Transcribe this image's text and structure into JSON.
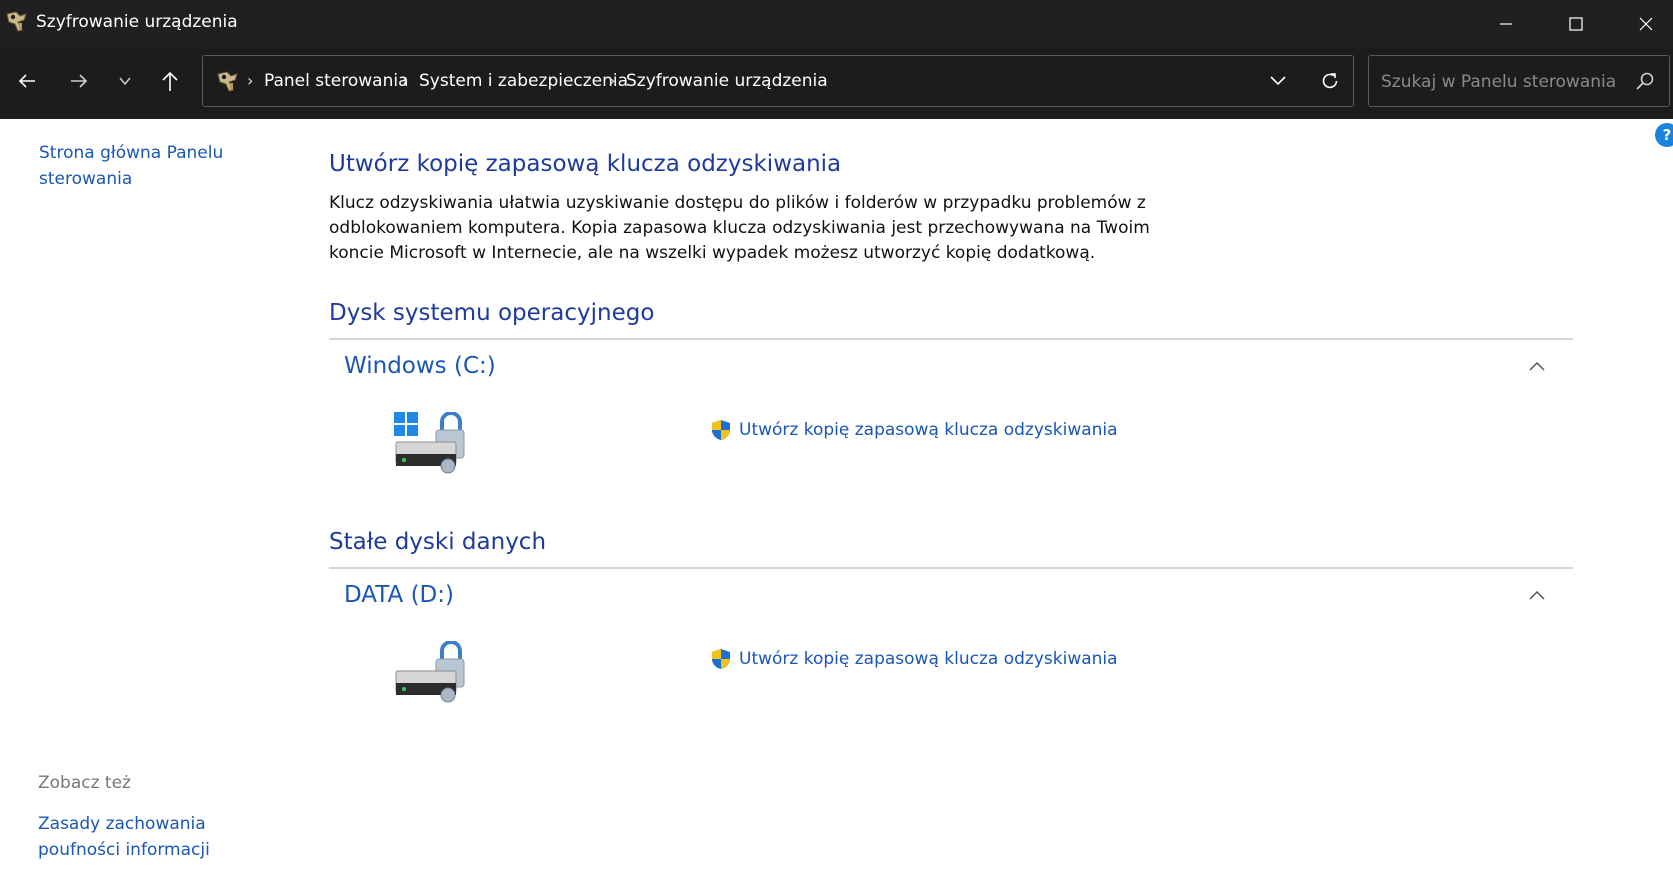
{
  "window": {
    "title": "Szyfrowanie urządzenia",
    "controls": [
      "minimize",
      "maximize",
      "close"
    ]
  },
  "nav": {
    "breadcrumbs": [
      "Panel sterowania",
      "System i zabezpieczenia",
      "Szyfrowanie urządzenia"
    ],
    "search_placeholder": "Szukaj w Panelu sterowania"
  },
  "sidebar": {
    "home_link": "Strona główna Panelu sterowania",
    "see_also_heading": "Zobacz też",
    "see_also_links": [
      "Zasady zachowania poufności informacji"
    ]
  },
  "main": {
    "title": "Utwórz kopię zapasową klucza odzyskiwania",
    "description": "Klucz odzyskiwania ułatwia uzyskiwanie dostępu do plików i folderów w przypadku problemów z odblokowaniem komputera. Kopia zapasowa klucza odzyskiwania jest przechowywana na Twoim koncie Microsoft w Internecie, ale na wszelki wypadek możesz utworzyć kopię dodatkową.",
    "sections": [
      {
        "title": "Dysk systemu operacyjnego",
        "drives": [
          {
            "name": "Windows (C:)",
            "icon": "os-drive-unlocked-icon",
            "action": "Utwórz kopię zapasową klucza odzyskiwania"
          }
        ]
      },
      {
        "title": "Stałe dyski danych",
        "drives": [
          {
            "name": "DATA (D:)",
            "icon": "data-drive-unlocked-icon",
            "action": "Utwórz kopię zapasową klucza odzyskiwania"
          }
        ]
      }
    ]
  },
  "colors": {
    "titlebar_bg": "#202020",
    "navbar_bg": "#1c1c1c",
    "heading": "#1e3a9c",
    "link": "#1a56b4",
    "help_badge": "#1a83dd"
  }
}
